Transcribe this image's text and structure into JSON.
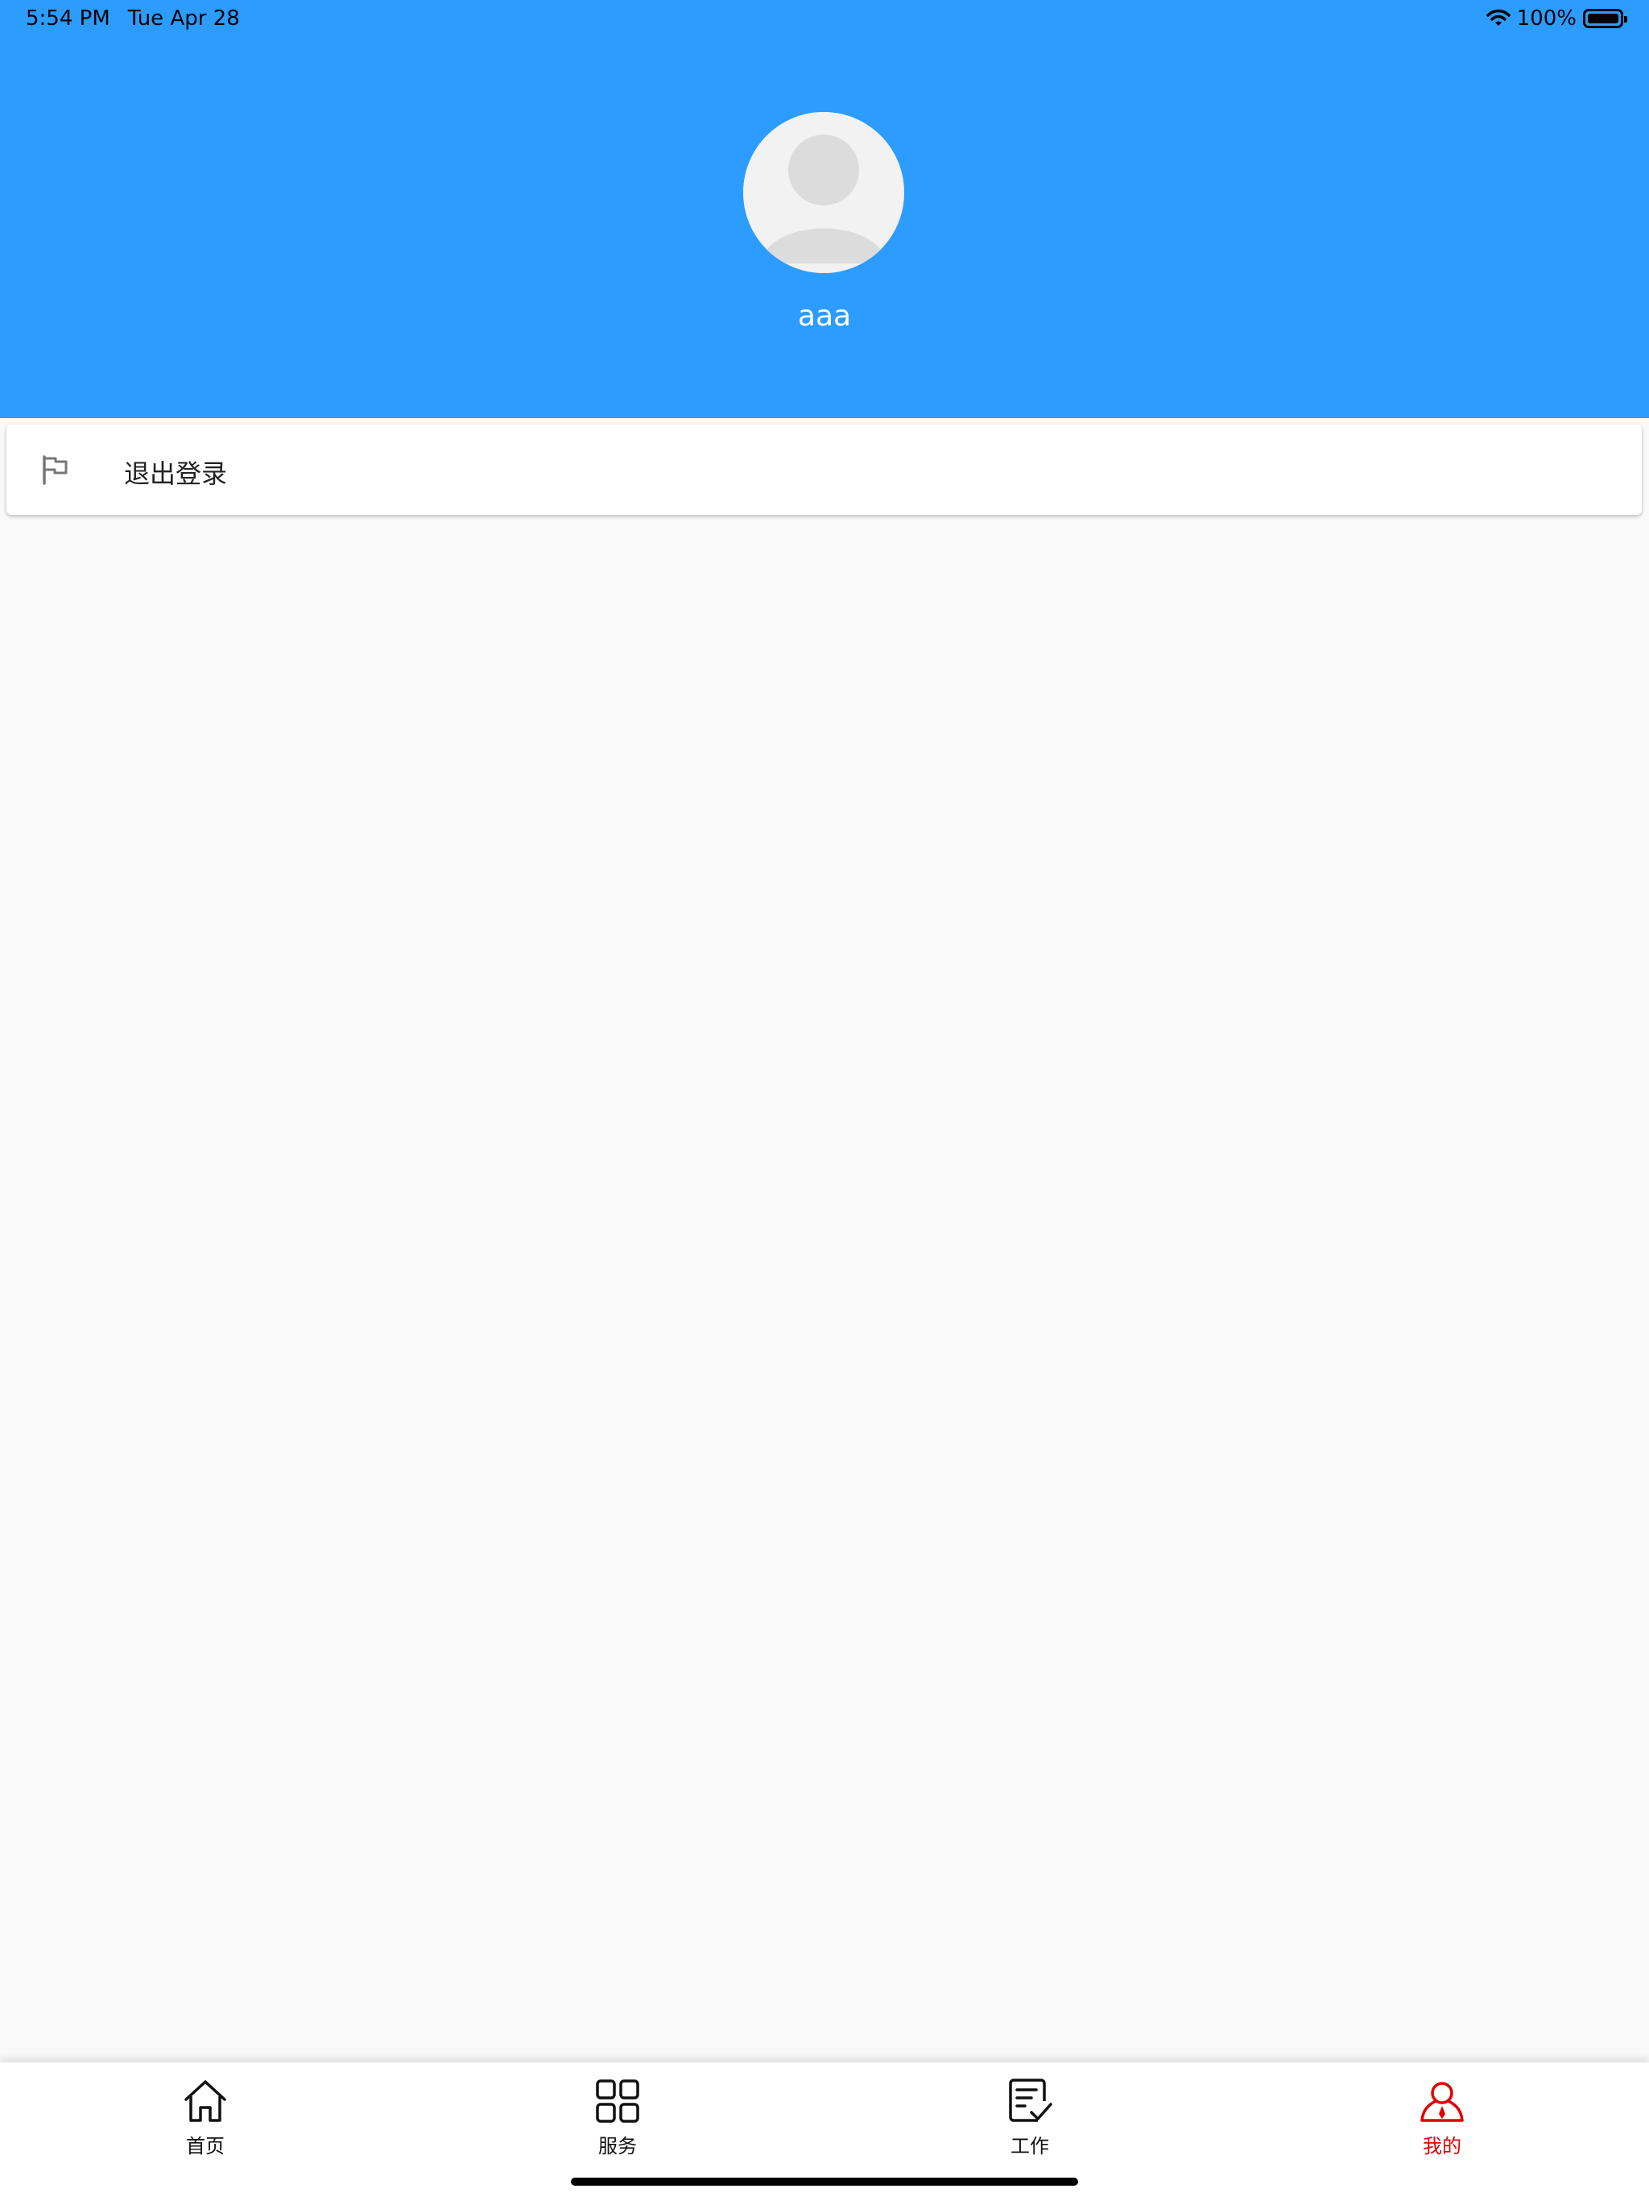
{
  "status_bar": {
    "time": "5:54 PM",
    "date": "Tue Apr 28",
    "battery": "100%"
  },
  "profile": {
    "username": "aaa"
  },
  "menu": {
    "items": [
      {
        "label": "退出登录",
        "icon": "flag-icon"
      }
    ]
  },
  "tabbar": {
    "tabs": [
      {
        "label": "首页",
        "icon": "home-icon"
      },
      {
        "label": "服务",
        "icon": "grid-icon"
      },
      {
        "label": "工作",
        "icon": "task-icon"
      },
      {
        "label": "我的",
        "icon": "user-icon",
        "active": true
      }
    ]
  },
  "colors": {
    "header_bg": "#2c9cfe",
    "active_tab": "#e10000"
  }
}
